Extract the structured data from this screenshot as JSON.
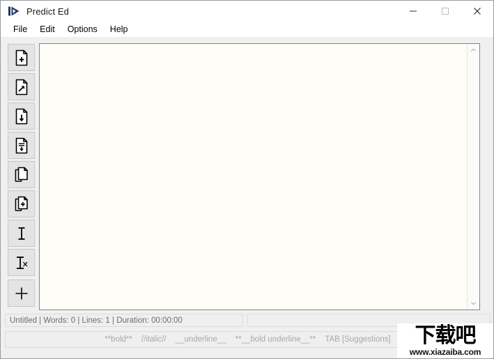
{
  "window": {
    "title": "Predict Ed",
    "icon": "play-triangle-icon",
    "controls": [
      {
        "name": "minimize-button",
        "label": "—"
      },
      {
        "name": "maximize-button",
        "label": "□"
      },
      {
        "name": "close-button",
        "label": "✕"
      }
    ]
  },
  "menubar": {
    "items": [
      {
        "label": "File"
      },
      {
        "label": "Edit"
      },
      {
        "label": "Options"
      },
      {
        "label": "Help"
      }
    ]
  },
  "toolbar": {
    "buttons": [
      {
        "name": "new-file-button",
        "icon": "file-plus-icon"
      },
      {
        "name": "open-file-button",
        "icon": "file-arrow-out-icon"
      },
      {
        "name": "save-file-button",
        "icon": "file-arrow-down-icon"
      },
      {
        "name": "save-as-button",
        "icon": "file-lines-arrow-down-icon"
      },
      {
        "name": "copy-button",
        "icon": "copy-pages-icon"
      },
      {
        "name": "duplicate-button",
        "icon": "copy-pages-plus-icon"
      },
      {
        "name": "insert-text-button",
        "icon": "text-cursor-icon"
      },
      {
        "name": "clear-formatting-button",
        "icon": "text-cursor-x-icon"
      },
      {
        "name": "add-button",
        "icon": "plus-icon"
      }
    ]
  },
  "editor": {
    "content": "",
    "background": "#fffdf5",
    "scrollbar": {
      "up_arrow": "chevron-up-icon",
      "down_arrow": "chevron-down-icon"
    }
  },
  "statusbar": {
    "left": "Untitled | Words: 0 | Lines: 1 | Duration: 00:00:00",
    "right": ""
  },
  "hintbar": {
    "tokens": [
      "**bold**",
      "//italic//",
      "__underline__",
      "**__bold underline__**",
      "TAB [Suggestions]"
    ]
  },
  "watermark": {
    "cn": "下载吧",
    "url": "www.xiazaiba.com"
  },
  "colors": {
    "accent": "#1f3864",
    "chrome": "#f0f0f0",
    "editor_bg": "#fffdf5",
    "hint_text": "#a8a8a8",
    "status_text": "#6d6d6d"
  }
}
